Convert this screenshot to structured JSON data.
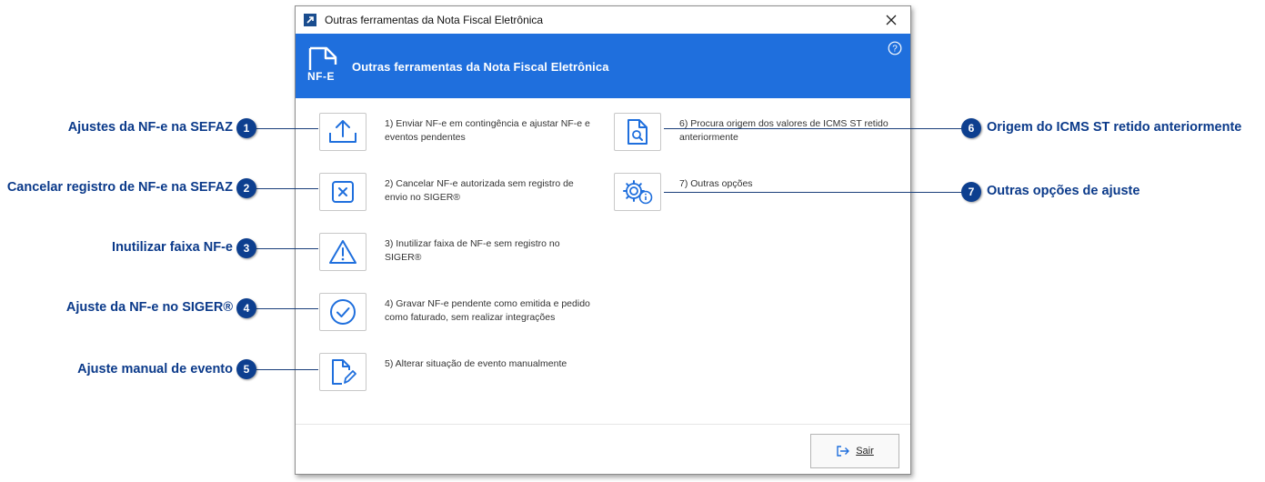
{
  "window": {
    "title": "Outras ferramentas da Nota Fiscal Eletrônica",
    "header_title": "Outras ferramentas da Nota Fiscal Eletrônica",
    "logo_text": "NF-E",
    "exit_label": "Sair"
  },
  "tools": [
    {
      "number": "1",
      "icon": "upload-icon",
      "label": "1) Enviar NF-e em contingência e ajustar NF-e e eventos pendentes"
    },
    {
      "number": "2",
      "icon": "close-box-icon",
      "label": "2) Cancelar NF-e autorizada sem registro de envio no SIGER®"
    },
    {
      "number": "3",
      "icon": "warning-icon",
      "label": "3) Inutilizar faixa de NF-e sem registro no SIGER®"
    },
    {
      "number": "4",
      "icon": "check-circle-icon",
      "label": "4) Gravar NF-e pendente como emitida e pedido como faturado, sem realizar integrações"
    },
    {
      "number": "5",
      "icon": "edit-document-icon",
      "label": "5) Alterar situação de evento manualmente"
    },
    {
      "number": "6",
      "icon": "document-search-icon",
      "label": "6) Procura origem dos valores de ICMS ST retido anteriormente"
    },
    {
      "number": "7",
      "icon": "gear-info-icon",
      "label": "7) Outras opções"
    }
  ],
  "callouts": [
    {
      "number": "1",
      "text": "Ajustes da NF-e na SEFAZ"
    },
    {
      "number": "2",
      "text": "Cancelar registro de NF-e na SEFAZ"
    },
    {
      "number": "3",
      "text": "Inutilizar faixa NF-e"
    },
    {
      "number": "4",
      "text": "Ajuste da NF-e no SIGER®"
    },
    {
      "number": "5",
      "text": "Ajuste manual de evento"
    },
    {
      "number": "6",
      "text": "Origem do ICMS ST retido anteriormente"
    },
    {
      "number": "7",
      "text": "Outras opções de ajuste"
    }
  ],
  "colors": {
    "header": "#1f6fdd",
    "icon": "#1f6fdd",
    "callout": "#0b3a8a",
    "badge": "#0d3f8f"
  }
}
